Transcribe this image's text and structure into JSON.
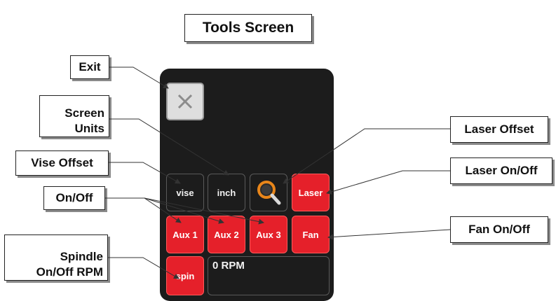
{
  "title": "Tools Screen",
  "callouts": {
    "exit": "Exit",
    "screen_units_line1": "Screen",
    "screen_units_line2": "Units",
    "vise_offset": "Vise Offset",
    "on_off": "On/Off",
    "spindle_line1": "Spindle",
    "spindle_line2": "On/Off RPM",
    "laser_offset": "Laser Offset",
    "laser_on_off": "Laser On/Off",
    "fan_on_off": "Fan On/Off"
  },
  "buttons": {
    "vise": "vise",
    "inch": "inch",
    "laser": "Laser",
    "aux1": "Aux 1",
    "aux2": "Aux 2",
    "aux3": "Aux 3",
    "fan": "Fan",
    "spin": "spin"
  },
  "rpm_readout": "0 RPM",
  "icons": {
    "exit": "close-icon",
    "laser_offset": "magnifier-icon"
  },
  "colors": {
    "panel": "#1c1c1c",
    "active_button": "#e5202a",
    "magnifier_ring": "#e8861a"
  }
}
